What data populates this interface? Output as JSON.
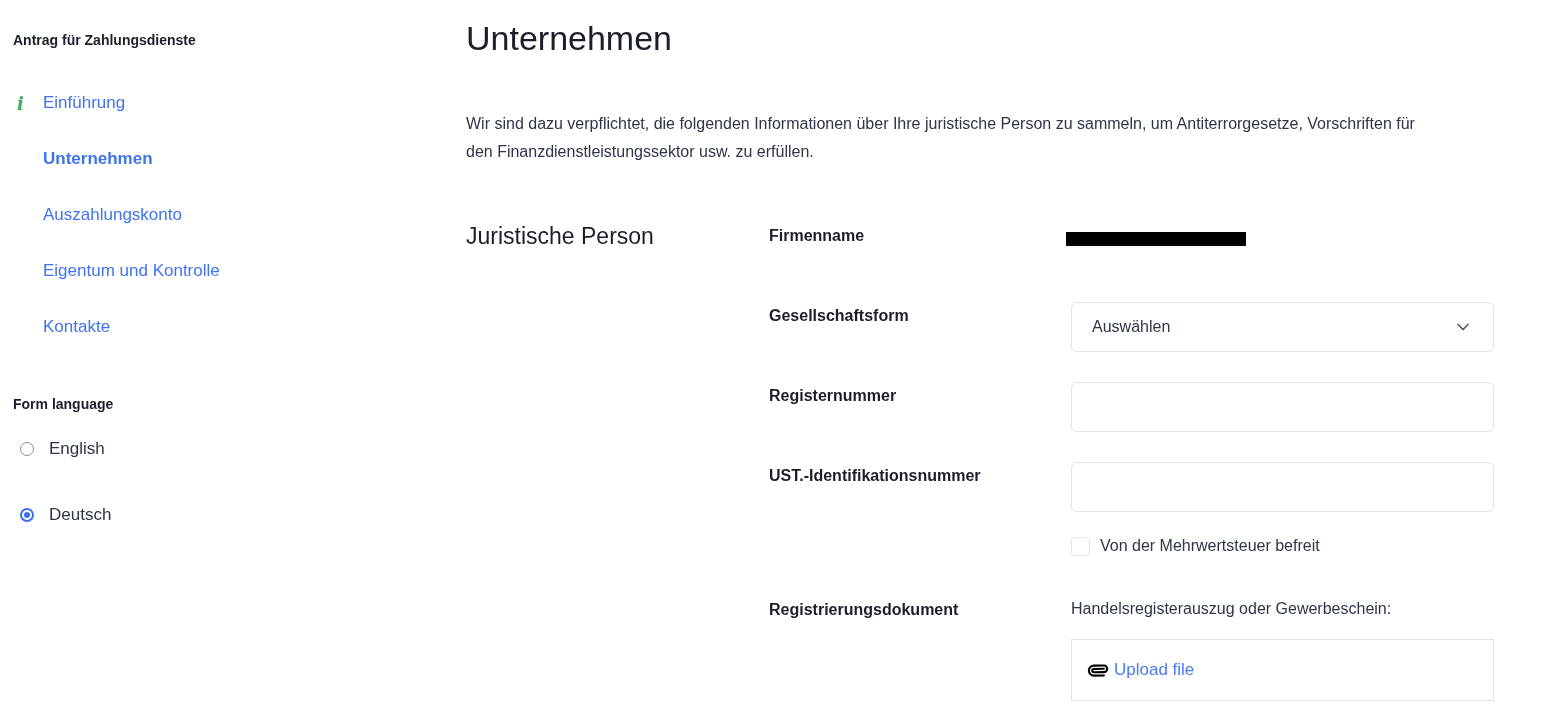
{
  "sidebar": {
    "heading": "Antrag für Zahlungsdienste",
    "items": [
      {
        "label": "Einführung",
        "icon": "i",
        "selected": false
      },
      {
        "label": "Unternehmen",
        "selected": true
      },
      {
        "label": "Auszahlungskonto",
        "selected": false
      },
      {
        "label": "Eigentum und Kontrolle",
        "selected": false
      },
      {
        "label": "Kontakte",
        "selected": false
      }
    ],
    "language": {
      "heading": "Form language",
      "options": [
        {
          "label": "English",
          "selected": false
        },
        {
          "label": "Deutsch",
          "selected": true
        }
      ]
    }
  },
  "main": {
    "title": "Unternehmen",
    "intro": "Wir sind dazu verpflichtet, die folgenden Informationen über Ihre juristische Person zu sammeln, um Antiterrorgesetze, Vorschriften für den Finanzdienstleistungssektor usw. zu erfüllen.",
    "section": {
      "title": "Juristische Person",
      "fields": [
        {
          "kind": "redacted",
          "label": "Firmenname"
        },
        {
          "kind": "select",
          "label": "Gesellschaftsform",
          "value": "Auswählen"
        },
        {
          "kind": "text",
          "label": "Registernummer"
        },
        {
          "kind": "text",
          "label": "UST.-Identifikationsnummer",
          "checkbox": {
            "label": "Von der Mehrwertsteuer befreit",
            "checked": false
          }
        },
        {
          "kind": "upload",
          "label": "Registrierungsdokument",
          "hint": "Handelsregisterauszug oder Gewerbeschein:",
          "button": "Upload file"
        }
      ]
    }
  }
}
